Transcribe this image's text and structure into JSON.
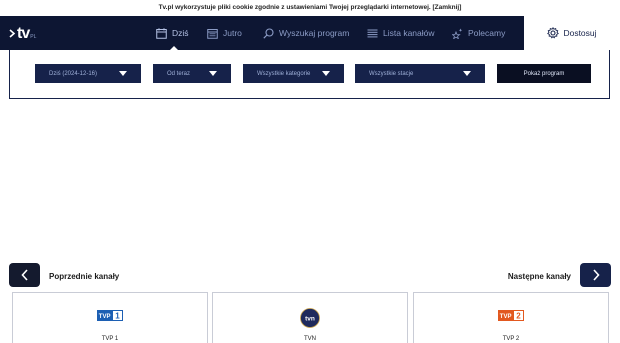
{
  "cookie": {
    "message": "Tv.pl wykorzystuje pliki cookie zgodnie z ustawieniami Twojej przeglądarki internetowej.",
    "close_label": "[Zamknij]"
  },
  "header": {
    "logo_text": "tv",
    "logo_suffix": "PL",
    "nav": [
      {
        "label": "Dziś",
        "icon": "calendar-icon"
      },
      {
        "label": "Jutro",
        "icon": "calendar-icon"
      },
      {
        "label": "Wyszukaj program",
        "icon": "search-icon"
      },
      {
        "label": "Lista kanałów",
        "icon": "list-icon"
      },
      {
        "label": "Polecamy",
        "icon": "stars-icon"
      }
    ],
    "customize_label": "Dostosuj"
  },
  "filters": {
    "day": "Dziś (2024-12-16)",
    "time": "Od teraz",
    "category": "Wszystkie kategorie",
    "station": "Wszystkie stacje",
    "show_label": "Pokaż program"
  },
  "channels_nav": {
    "prev_label": "Poprzednie kanały",
    "next_label": "Następne kanały"
  },
  "channels": [
    {
      "name": "TVP 1",
      "logo_text": "TVP 1"
    },
    {
      "name": "TVN",
      "logo_text": "tvn"
    },
    {
      "name": "TVP 2",
      "logo_text": "TVP 2"
    }
  ],
  "colors": {
    "navbar": "#0d1633",
    "filter_bg": "#16224a",
    "tvp1_blue": "#1c5fb3",
    "tvn_navy": "#1f2a5c",
    "tvp2_orange": "#e2581f"
  }
}
